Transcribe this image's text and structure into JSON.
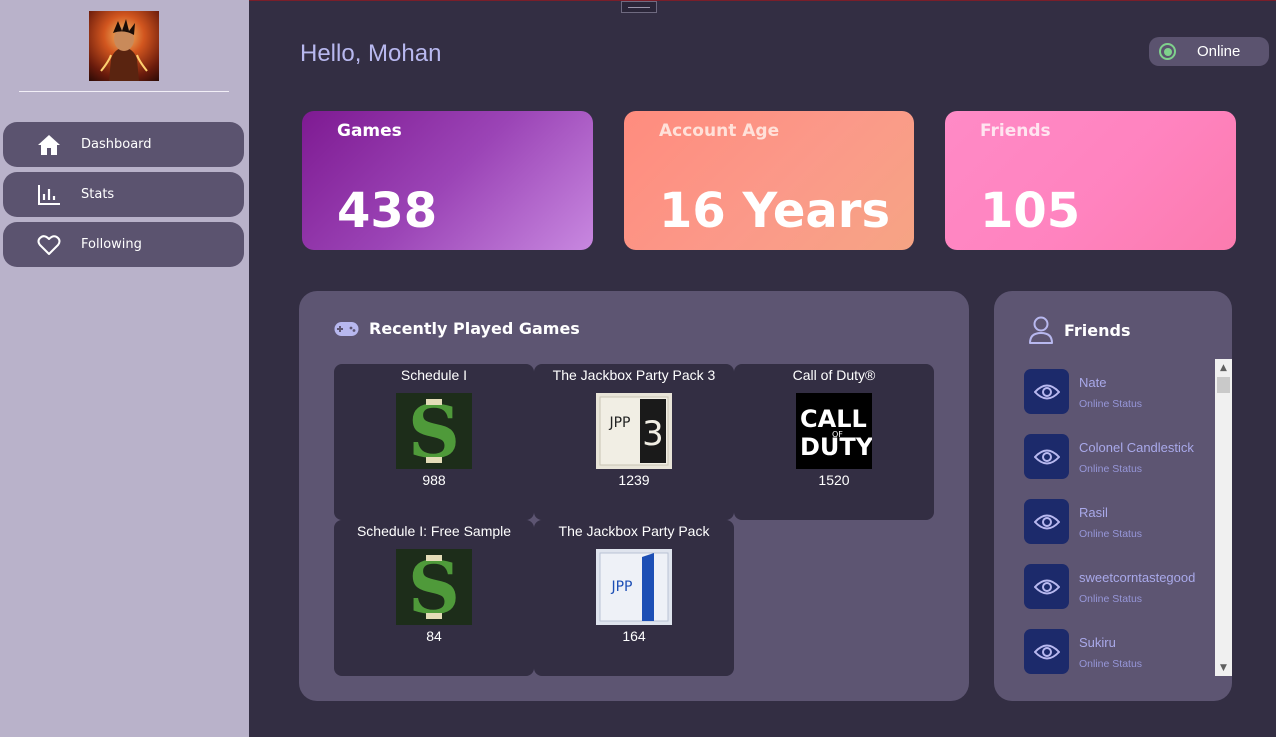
{
  "greeting": "Hello, Mohan",
  "status": {
    "label": "Online",
    "color": "#7fd18c"
  },
  "sidebar": {
    "avatar_icon": "player-avatar",
    "items": [
      {
        "label": "Dashboard",
        "icon": "home-icon"
      },
      {
        "label": "Stats",
        "icon": "bar-chart-icon"
      },
      {
        "label": "Following",
        "icon": "heart-icon"
      }
    ]
  },
  "stats": {
    "games": {
      "title": "Games",
      "value": "438"
    },
    "account_age": {
      "title": "Account Age",
      "value": "16 Years"
    },
    "friends": {
      "title": "Friends",
      "value": "105"
    }
  },
  "recent_games": {
    "title": "Recently Played Games",
    "icon": "gamepad-icon",
    "items": [
      {
        "name": "Schedule I",
        "count": "988",
        "icon": "schedule-one-logo"
      },
      {
        "name": "The Jackbox Party Pack 3",
        "count": "1239",
        "icon": "jackbox-3-logo"
      },
      {
        "name": "Call of Duty®",
        "count": "1520",
        "icon": "call-of-duty-logo"
      },
      {
        "name": "Schedule I: Free Sample",
        "count": "84",
        "icon": "schedule-one-logo"
      },
      {
        "name": "The Jackbox Party Pack",
        "count": "164",
        "icon": "jackbox-1-logo"
      }
    ]
  },
  "friends_panel": {
    "title": "Friends",
    "icon": "user-icon",
    "items": [
      {
        "name": "Nate",
        "status": "Online Status"
      },
      {
        "name": "Colonel Candlestick",
        "status": "Online Status"
      },
      {
        "name": "Rasil",
        "status": "Online Status"
      },
      {
        "name": "sweetcorntastegood",
        "status": "Online Status"
      },
      {
        "name": "Sukiru",
        "status": "Online Status"
      }
    ]
  },
  "colors": {
    "background": "#332e43",
    "sidebar": "#b9b2ca",
    "panel": "#5d5572",
    "accent_text": "#b8b8ef",
    "friend_eye_bg": "#1c2a6b"
  }
}
